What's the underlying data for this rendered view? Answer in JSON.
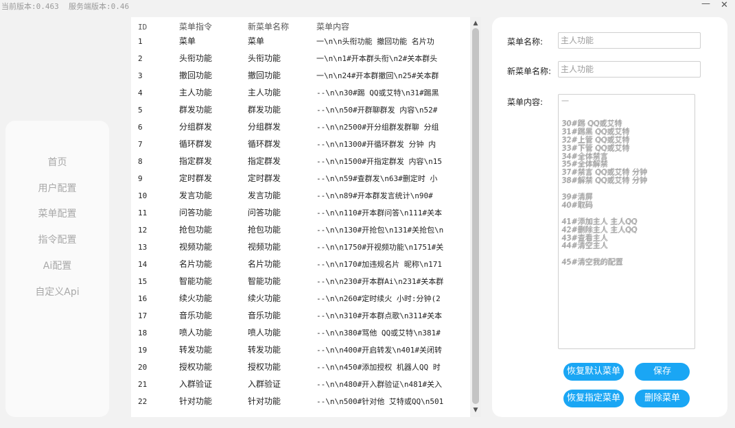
{
  "header": {
    "client_version": "当前版本:0.463",
    "server_version": "服务端版本:0.46",
    "minimize_label": "—",
    "close_label": "✕"
  },
  "sidebar": {
    "items": [
      {
        "label": "首页"
      },
      {
        "label": "用户配置"
      },
      {
        "label": "菜单配置"
      },
      {
        "label": "指令配置"
      },
      {
        "label": "Ai配置"
      },
      {
        "label": "自定义Api"
      }
    ]
  },
  "table": {
    "columns": [
      "ID",
      "菜单指令",
      "新菜单名称",
      "菜单内容"
    ],
    "rows": [
      [
        "1",
        "菜单",
        "菜单",
        "一\\n\\n头衔功能 撤回功能 名片功"
      ],
      [
        "2",
        "头衔功能",
        "头衔功能",
        "一\\n\\n1#开本群头衔\\n2#关本群头"
      ],
      [
        "3",
        "撤回功能",
        "撤回功能",
        "一\\n\\n24#开本群撤回\\n25#关本群"
      ],
      [
        "4",
        "主人功能",
        "主人功能",
        "--\\n\\n30#踢 QQ或艾特\\n31#踢黑"
      ],
      [
        "5",
        "群发功能",
        "群发功能",
        "--\\n\\n50#开群聊群发 内容\\n52#"
      ],
      [
        "6",
        "分组群发",
        "分组群发",
        "--\\n\\n2500#开分组群发群聊 分组"
      ],
      [
        "7",
        "循环群发",
        "循环群发",
        "--\\n\\n1300#开循环群发 分钟 内"
      ],
      [
        "8",
        "指定群发",
        "指定群发",
        "--\\n\\n1500#开指定群发 内容\\n15"
      ],
      [
        "9",
        "定时群发",
        "定时群发",
        "--\\n\\n59#查群发\\n63#删定时 小"
      ],
      [
        "10",
        "发言功能",
        "发言功能",
        "--\\n\\n89#开本群发言统计\\n90#"
      ],
      [
        "11",
        "问答功能",
        "问答功能",
        "--\\n\\n110#开本群问答\\n111#关本"
      ],
      [
        "12",
        "抢包功能",
        "抢包功能",
        "--\\n\\n130#开抢包\\n131#关抢包\\n"
      ],
      [
        "13",
        "视频功能",
        "视频功能",
        "--\\n\\n1750#开视频功能\\n1751#关"
      ],
      [
        "14",
        "名片功能",
        "名片功能",
        "--\\n\\n170#加违规名片 昵称\\n171"
      ],
      [
        "15",
        "智能功能",
        "智能功能",
        "--\\n\\n230#开本群Ai\\n231#关本群"
      ],
      [
        "16",
        "续火功能",
        "续火功能",
        "--\\n\\n260#定时续火 小时:分钟(2"
      ],
      [
        "17",
        "音乐功能",
        "音乐功能",
        "--\\n\\n310#开本群点歌\\n311#关本"
      ],
      [
        "18",
        "喷人功能",
        "喷人功能",
        "--\\n\\n380#骂他 QQ或艾特\\n381#"
      ],
      [
        "19",
        "转发功能",
        "转发功能",
        "--\\n\\n400#开启转发\\n401#关闭转"
      ],
      [
        "20",
        "授权功能",
        "授权功能",
        "--\\n\\n450#添加授权 机器人QQ 时"
      ],
      [
        "21",
        "入群验证",
        "入群验证",
        "--\\n\\n480#开入群验证\\n481#关入"
      ],
      [
        "22",
        "针对功能",
        "针对功能",
        "--\\n\\n500#针对他 艾特或QQ\\n501"
      ]
    ]
  },
  "scrollbar": {
    "up_icon": "▲",
    "down_icon": "▼"
  },
  "form": {
    "menu_name_label": "菜单名称:",
    "menu_name_value": "主人功能",
    "new_menu_name_label": "新菜单名称:",
    "new_menu_name_value": "主人功能",
    "menu_content_label": "菜单内容:",
    "content_lines": [
      "一",
      "",
      "30#踢 QQ或艾特",
      "31#踢黑 QQ或艾特",
      "32#上管 QQ或艾特",
      "33#下管 QQ或艾特",
      "34#全体禁言",
      "35#全体解禁",
      "37#禁言 QQ或艾特 分钟",
      "38#解禁 QQ或艾特 分钟",
      "",
      "39#清屏",
      "40#取码",
      "",
      "41#添加主人 主人QQ",
      "42#删除主人 主人QQ",
      "43#查看主人",
      "44#清空主人",
      "",
      "45#清空我的配置"
    ]
  },
  "buttons": {
    "restore_default": "恢复默认菜单",
    "save": "保存",
    "restore_specified": "恢复指定菜单",
    "delete": "删除菜单"
  },
  "colors": {
    "accent": "#1aa6f4",
    "background": "#f2f2f2",
    "panel": "#ffffff"
  }
}
